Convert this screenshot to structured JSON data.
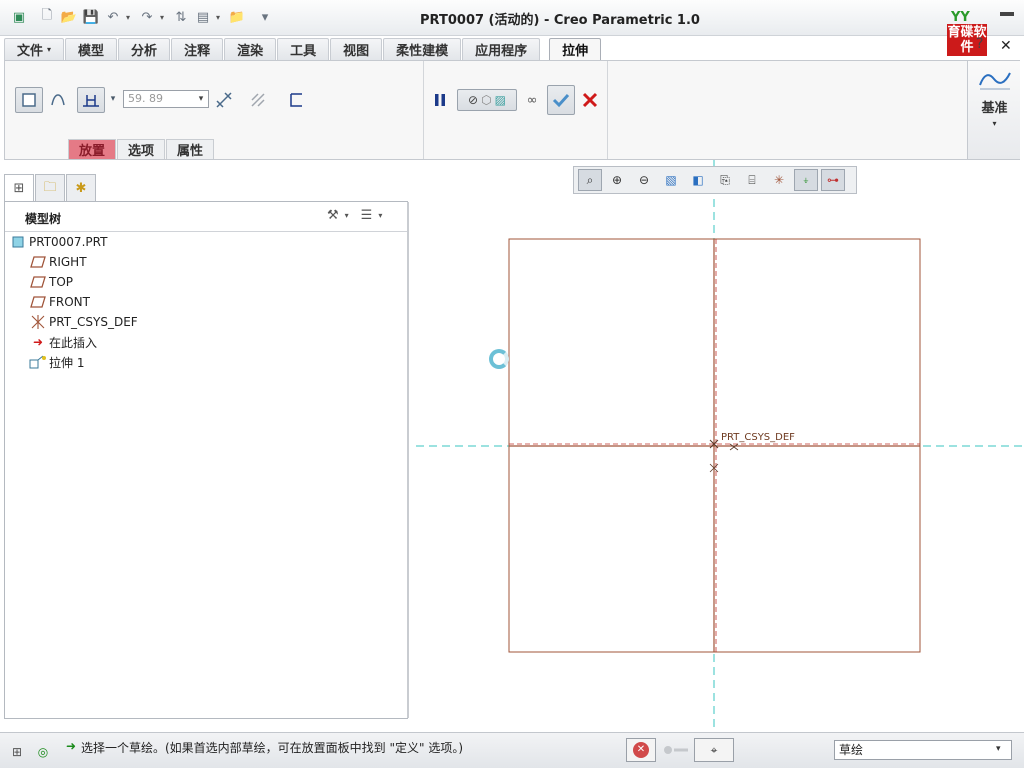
{
  "window": {
    "title": "PRT0007 (活动的) - Creo Parametric 1.0",
    "logo_text": "育碟软件",
    "logo_leaf": "YY"
  },
  "quick_access": [
    "app-icon",
    "new-icon",
    "open-icon",
    "save-icon",
    "undo-icon",
    "redo-icon",
    "regenerate-icon",
    "windows-icon",
    "folder-icon",
    "customize-icon"
  ],
  "ribbon": {
    "tabs": [
      {
        "label": "文件",
        "active": false,
        "caret": "▾"
      },
      {
        "label": "模型",
        "active": false
      },
      {
        "label": "分析",
        "active": false
      },
      {
        "label": "注释",
        "active": false
      },
      {
        "label": "渲染",
        "active": false
      },
      {
        "label": "工具",
        "active": false
      },
      {
        "label": "视图",
        "active": false
      },
      {
        "label": "柔性建模",
        "active": false
      },
      {
        "label": "应用程序",
        "active": false
      },
      {
        "label": "拉伸",
        "active": true
      }
    ],
    "depth_value": "59. 89",
    "panel_tabs": [
      {
        "label": "放置",
        "active": true
      },
      {
        "label": "选项",
        "active": false
      },
      {
        "label": "属性",
        "active": false
      }
    ],
    "datum_label": "基准",
    "colors": {
      "confirm": "#4a8fc9",
      "cancel": "#d01a1a",
      "pause": "#1c3a8a",
      "active_panel_tab": "#e57a86"
    }
  },
  "model_tree": {
    "title": "模型树",
    "items": [
      {
        "label": "PRT0007.PRT",
        "icon": "part-icon",
        "level": 0
      },
      {
        "label": "RIGHT",
        "icon": "datum-plane-icon",
        "level": 1
      },
      {
        "label": "TOP",
        "icon": "datum-plane-icon",
        "level": 1
      },
      {
        "label": "FRONT",
        "icon": "datum-plane-icon",
        "level": 1
      },
      {
        "label": "PRT_CSYS_DEF",
        "icon": "csys-icon",
        "level": 1
      },
      {
        "label": "在此插入",
        "icon": "insert-here-icon",
        "level": 1
      },
      {
        "label": "拉伸 1",
        "icon": "extrude-icon",
        "level": 1
      }
    ]
  },
  "graphics": {
    "csys_label": "PRT_CSYS_DEF",
    "colors": {
      "datum_plane": "#a0553a",
      "axis": "#39c5c0",
      "sketch": "#c0302a"
    }
  },
  "status": {
    "message": "选择一个草绘。(如果首选内部草绘，可在放置面板中找到 \"定义\" 选项。)",
    "filter_value": "草绘"
  }
}
